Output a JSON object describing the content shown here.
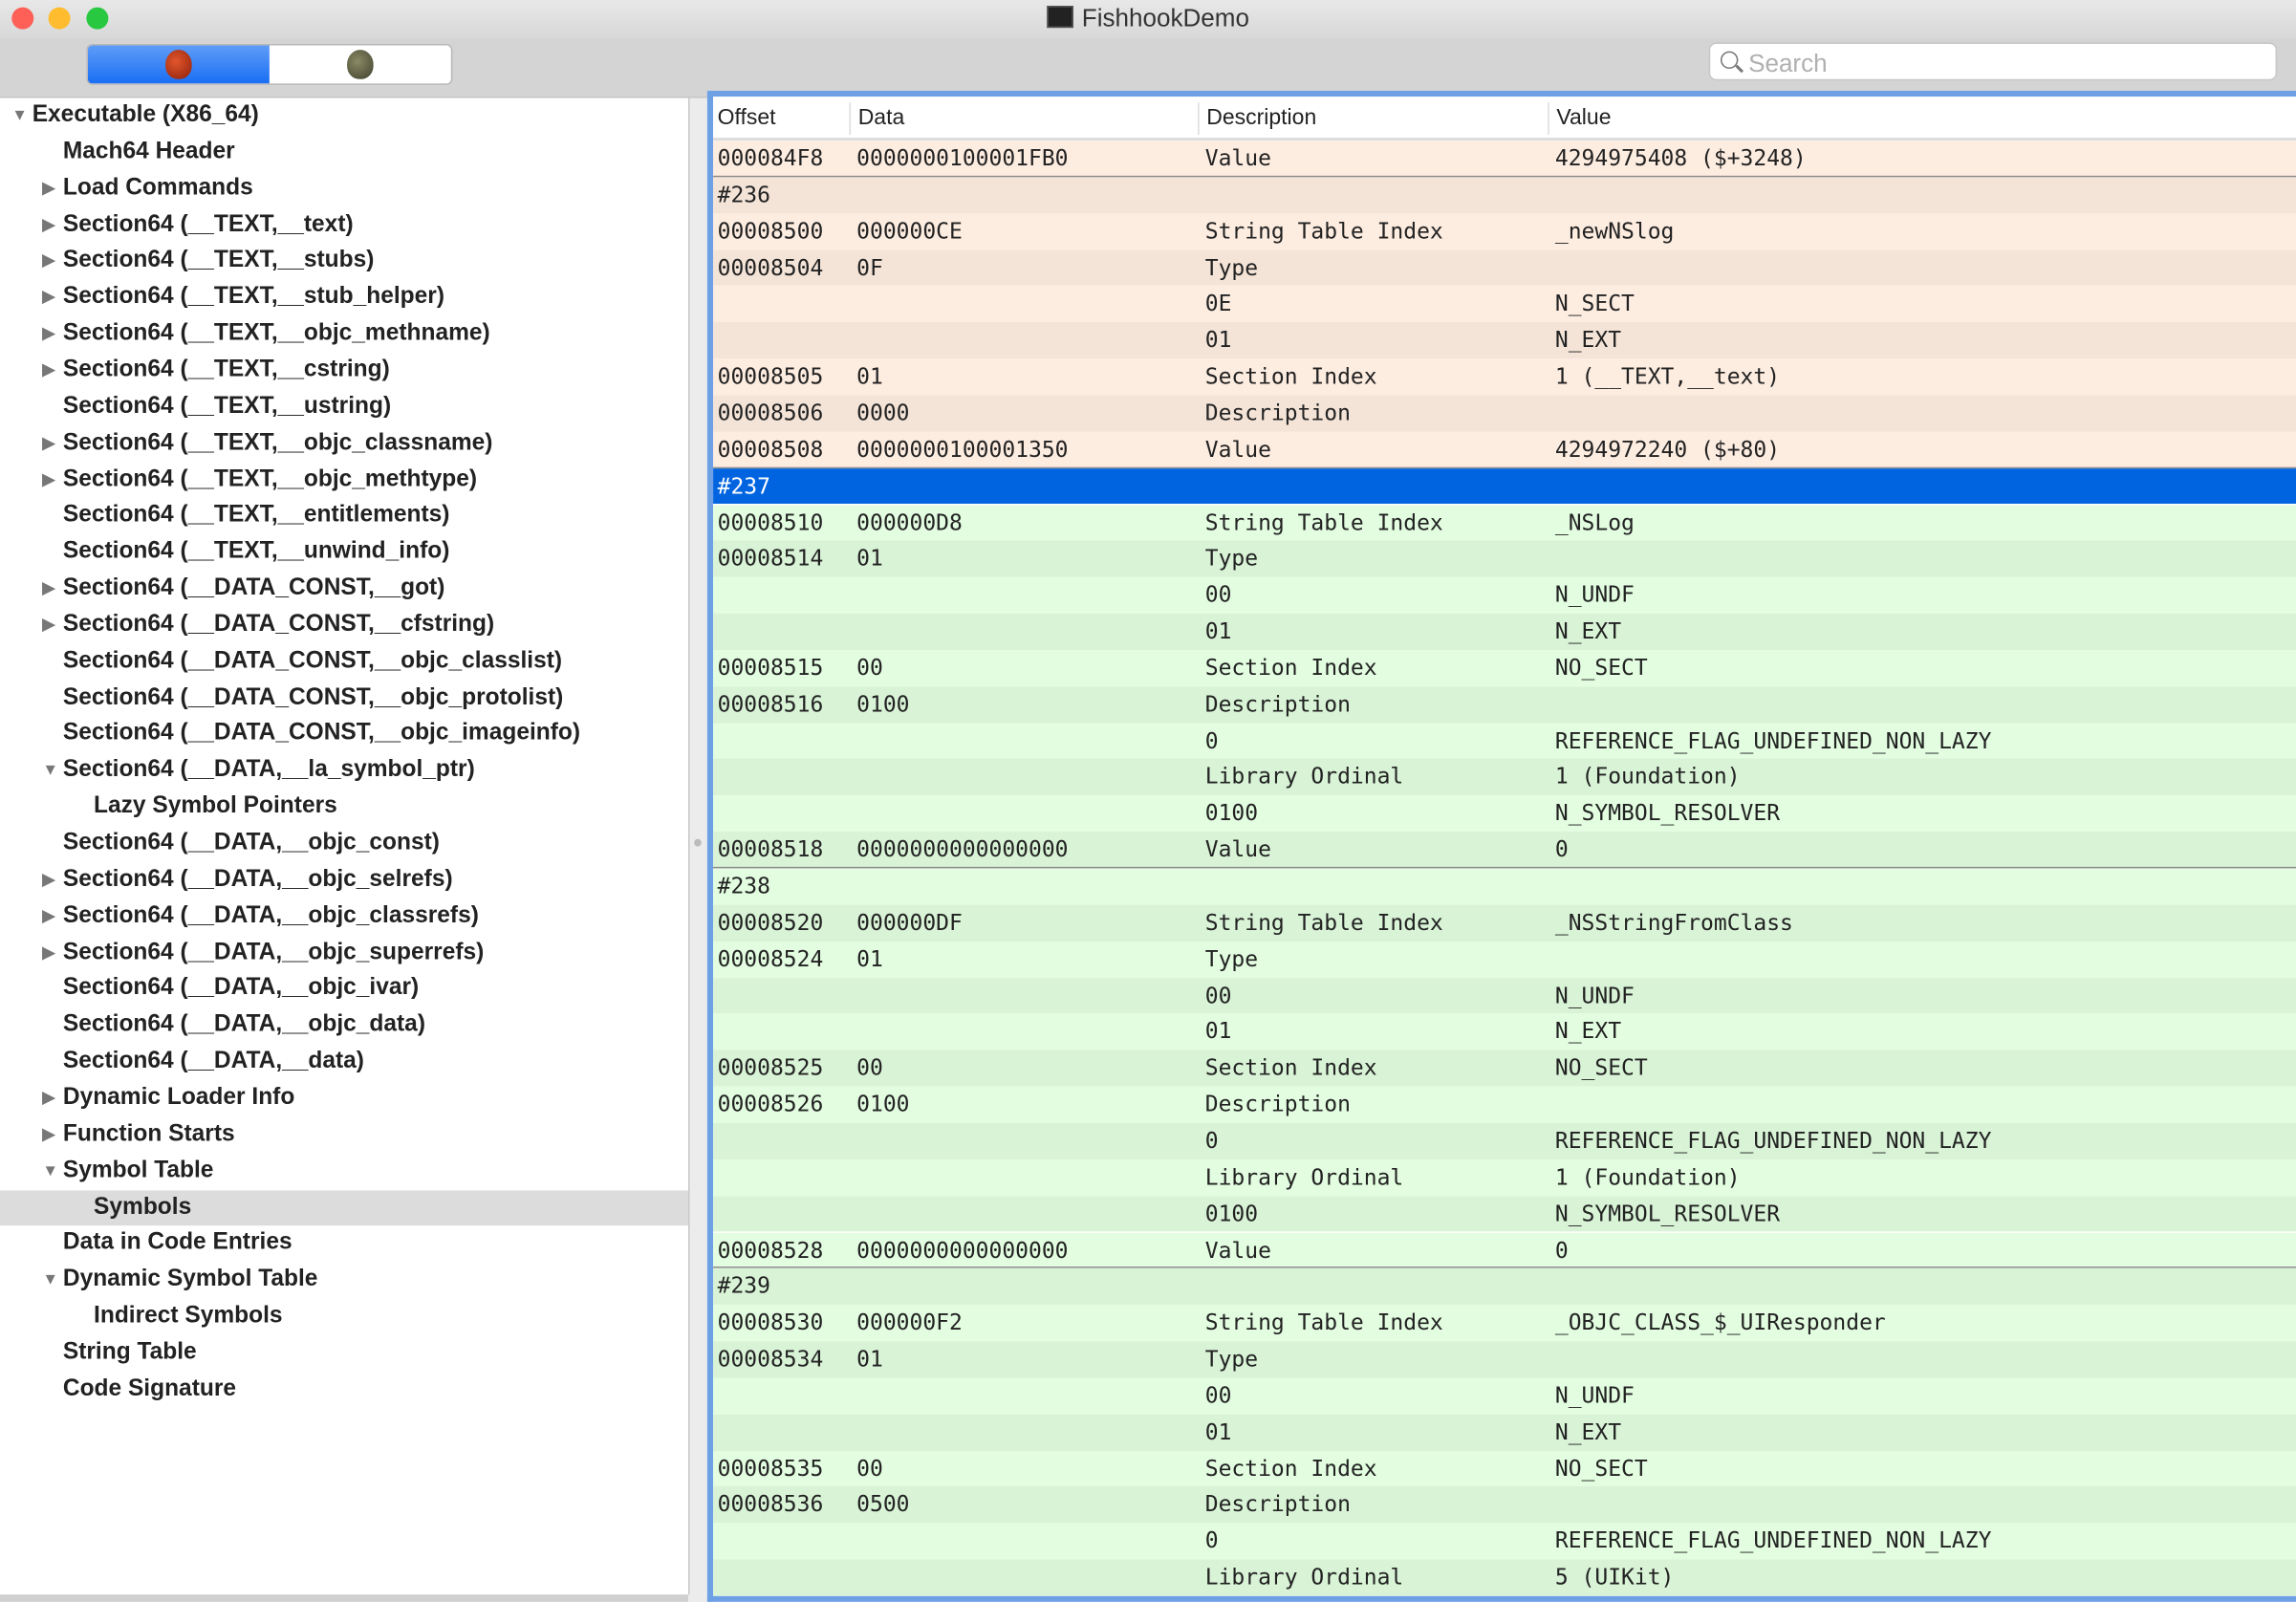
{
  "window": {
    "title": "FishhookDemo",
    "traffic_lights": {
      "close": "#fe5f57",
      "minimize": "#febc2e",
      "zoom": "#28c840"
    }
  },
  "toolbar": {
    "segments": [
      {
        "icon": "apple-red-icon",
        "selected": true
      },
      {
        "icon": "apple-gray-icon",
        "selected": false
      }
    ],
    "search": {
      "placeholder": "Search",
      "value": ""
    }
  },
  "sidebar": {
    "items": [
      {
        "label": "Executable  (X86_64)",
        "level": 0,
        "toggle": "expanded"
      },
      {
        "label": "Mach64 Header",
        "level": 1,
        "toggle": "none"
      },
      {
        "label": "Load Commands",
        "level": 1,
        "toggle": "collapsed"
      },
      {
        "label": "Section64 (__TEXT,__text)",
        "level": 1,
        "toggle": "collapsed"
      },
      {
        "label": "Section64 (__TEXT,__stubs)",
        "level": 1,
        "toggle": "collapsed"
      },
      {
        "label": "Section64 (__TEXT,__stub_helper)",
        "level": 1,
        "toggle": "collapsed"
      },
      {
        "label": "Section64 (__TEXT,__objc_methname)",
        "level": 1,
        "toggle": "collapsed"
      },
      {
        "label": "Section64 (__TEXT,__cstring)",
        "level": 1,
        "toggle": "collapsed"
      },
      {
        "label": "Section64 (__TEXT,__ustring)",
        "level": 1,
        "toggle": "none"
      },
      {
        "label": "Section64 (__TEXT,__objc_classname)",
        "level": 1,
        "toggle": "collapsed"
      },
      {
        "label": "Section64 (__TEXT,__objc_methtype)",
        "level": 1,
        "toggle": "collapsed"
      },
      {
        "label": "Section64 (__TEXT,__entitlements)",
        "level": 1,
        "toggle": "none"
      },
      {
        "label": "Section64 (__TEXT,__unwind_info)",
        "level": 1,
        "toggle": "none"
      },
      {
        "label": "Section64 (__DATA_CONST,__got)",
        "level": 1,
        "toggle": "collapsed"
      },
      {
        "label": "Section64 (__DATA_CONST,__cfstring)",
        "level": 1,
        "toggle": "collapsed"
      },
      {
        "label": "Section64 (__DATA_CONST,__objc_classlist)",
        "level": 1,
        "toggle": "none"
      },
      {
        "label": "Section64 (__DATA_CONST,__objc_protolist)",
        "level": 1,
        "toggle": "none"
      },
      {
        "label": "Section64 (__DATA_CONST,__objc_imageinfo)",
        "level": 1,
        "toggle": "none"
      },
      {
        "label": "Section64 (__DATA,__la_symbol_ptr)",
        "level": 1,
        "toggle": "expanded"
      },
      {
        "label": "Lazy Symbol Pointers",
        "level": 2,
        "toggle": "none"
      },
      {
        "label": "Section64 (__DATA,__objc_const)",
        "level": 1,
        "toggle": "none"
      },
      {
        "label": "Section64 (__DATA,__objc_selrefs)",
        "level": 1,
        "toggle": "collapsed"
      },
      {
        "label": "Section64 (__DATA,__objc_classrefs)",
        "level": 1,
        "toggle": "collapsed"
      },
      {
        "label": "Section64 (__DATA,__objc_superrefs)",
        "level": 1,
        "toggle": "collapsed"
      },
      {
        "label": "Section64 (__DATA,__objc_ivar)",
        "level": 1,
        "toggle": "none"
      },
      {
        "label": "Section64 (__DATA,__objc_data)",
        "level": 1,
        "toggle": "none"
      },
      {
        "label": "Section64 (__DATA,__data)",
        "level": 1,
        "toggle": "none"
      },
      {
        "label": "Dynamic Loader Info",
        "level": 1,
        "toggle": "collapsed"
      },
      {
        "label": "Function Starts",
        "level": 1,
        "toggle": "collapsed"
      },
      {
        "label": "Symbol Table",
        "level": 1,
        "toggle": "expanded"
      },
      {
        "label": "Symbols",
        "level": 2,
        "toggle": "none",
        "selected": true
      },
      {
        "label": "Data in Code Entries",
        "level": 1,
        "toggle": "none"
      },
      {
        "label": "Dynamic Symbol Table",
        "level": 1,
        "toggle": "expanded"
      },
      {
        "label": "Indirect Symbols",
        "level": 2,
        "toggle": "none"
      },
      {
        "label": "String Table",
        "level": 1,
        "toggle": "none"
      },
      {
        "label": "Code Signature",
        "level": 1,
        "toggle": "none"
      }
    ]
  },
  "table": {
    "columns": [
      "Offset",
      "Data",
      "Description",
      "Value"
    ],
    "colors": {
      "pink_a": "#fdece0",
      "pink_b": "#f4e4d8",
      "green_a": "#e2fde0",
      "green_b": "#d8f3d6",
      "selected": "#0064e1"
    },
    "rows": [
      {
        "c": [
          "000084F8",
          "0000000100001FB0",
          "Value",
          "4294975408 ($+3248)"
        ],
        "g": "pink",
        "end": true
      },
      {
        "c": [
          "#236",
          "",
          "",
          ""
        ],
        "g": "pink"
      },
      {
        "c": [
          "00008500",
          "000000CE",
          "String Table Index",
          "_newNSlog"
        ],
        "g": "pink"
      },
      {
        "c": [
          "00008504",
          "0F",
          "Type",
          ""
        ],
        "g": "pink"
      },
      {
        "c": [
          "",
          "",
          "0E",
          "N_SECT"
        ],
        "g": "pink"
      },
      {
        "c": [
          "",
          "",
          "01",
          "N_EXT"
        ],
        "g": "pink"
      },
      {
        "c": [
          "00008505",
          "01",
          "Section Index",
          "1 (__TEXT,__text)"
        ],
        "g": "pink"
      },
      {
        "c": [
          "00008506",
          "0000",
          "Description",
          ""
        ],
        "g": "pink"
      },
      {
        "c": [
          "00008508",
          "0000000100001350",
          "Value",
          "4294972240 ($+80)"
        ],
        "g": "pink",
        "end": true
      },
      {
        "c": [
          "#237",
          "",
          "",
          ""
        ],
        "g": "selected"
      },
      {
        "c": [
          "00008510",
          "000000D8",
          "String Table Index",
          "_NSLog"
        ],
        "g": "green"
      },
      {
        "c": [
          "00008514",
          "01",
          "Type",
          ""
        ],
        "g": "green"
      },
      {
        "c": [
          "",
          "",
          "00",
          "N_UNDF"
        ],
        "g": "green"
      },
      {
        "c": [
          "",
          "",
          "01",
          "N_EXT"
        ],
        "g": "green"
      },
      {
        "c": [
          "00008515",
          "00",
          "Section Index",
          "NO_SECT"
        ],
        "g": "green"
      },
      {
        "c": [
          "00008516",
          "0100",
          "Description",
          ""
        ],
        "g": "green"
      },
      {
        "c": [
          "",
          "",
          "0",
          "REFERENCE_FLAG_UNDEFINED_NON_LAZY"
        ],
        "g": "green"
      },
      {
        "c": [
          "",
          "",
          "Library Ordinal",
          "1 (Foundation)"
        ],
        "g": "green"
      },
      {
        "c": [
          "",
          "",
          "0100",
          "N_SYMBOL_RESOLVER"
        ],
        "g": "green"
      },
      {
        "c": [
          "00008518",
          "0000000000000000",
          "Value",
          "0"
        ],
        "g": "green",
        "end": true
      },
      {
        "c": [
          "#238",
          "",
          "",
          ""
        ],
        "g": "green"
      },
      {
        "c": [
          "00008520",
          "000000DF",
          "String Table Index",
          "_NSStringFromClass"
        ],
        "g": "green"
      },
      {
        "c": [
          "00008524",
          "01",
          "Type",
          ""
        ],
        "g": "green"
      },
      {
        "c": [
          "",
          "",
          "00",
          "N_UNDF"
        ],
        "g": "green"
      },
      {
        "c": [
          "",
          "",
          "01",
          "N_EXT"
        ],
        "g": "green"
      },
      {
        "c": [
          "00008525",
          "00",
          "Section Index",
          "NO_SECT"
        ],
        "g": "green"
      },
      {
        "c": [
          "00008526",
          "0100",
          "Description",
          ""
        ],
        "g": "green"
      },
      {
        "c": [
          "",
          "",
          "0",
          "REFERENCE_FLAG_UNDEFINED_NON_LAZY"
        ],
        "g": "green"
      },
      {
        "c": [
          "",
          "",
          "Library Ordinal",
          "1 (Foundation)"
        ],
        "g": "green"
      },
      {
        "c": [
          "",
          "",
          "0100",
          "N_SYMBOL_RESOLVER"
        ],
        "g": "green"
      },
      {
        "c": [
          "00008528",
          "0000000000000000",
          "Value",
          "0"
        ],
        "g": "green",
        "end": true
      },
      {
        "c": [
          "#239",
          "",
          "",
          ""
        ],
        "g": "green"
      },
      {
        "c": [
          "00008530",
          "000000F2",
          "String Table Index",
          "_OBJC_CLASS_$_UIResponder"
        ],
        "g": "green"
      },
      {
        "c": [
          "00008534",
          "01",
          "Type",
          ""
        ],
        "g": "green"
      },
      {
        "c": [
          "",
          "",
          "00",
          "N_UNDF"
        ],
        "g": "green"
      },
      {
        "c": [
          "",
          "",
          "01",
          "N_EXT"
        ],
        "g": "green"
      },
      {
        "c": [
          "00008535",
          "00",
          "Section Index",
          "NO_SECT"
        ],
        "g": "green"
      },
      {
        "c": [
          "00008536",
          "0500",
          "Description",
          ""
        ],
        "g": "green"
      },
      {
        "c": [
          "",
          "",
          "0",
          "REFERENCE_FLAG_UNDEFINED_NON_LAZY"
        ],
        "g": "green"
      },
      {
        "c": [
          "",
          "",
          "Library Ordinal",
          "5 (UIKit)"
        ],
        "g": "green"
      }
    ]
  }
}
